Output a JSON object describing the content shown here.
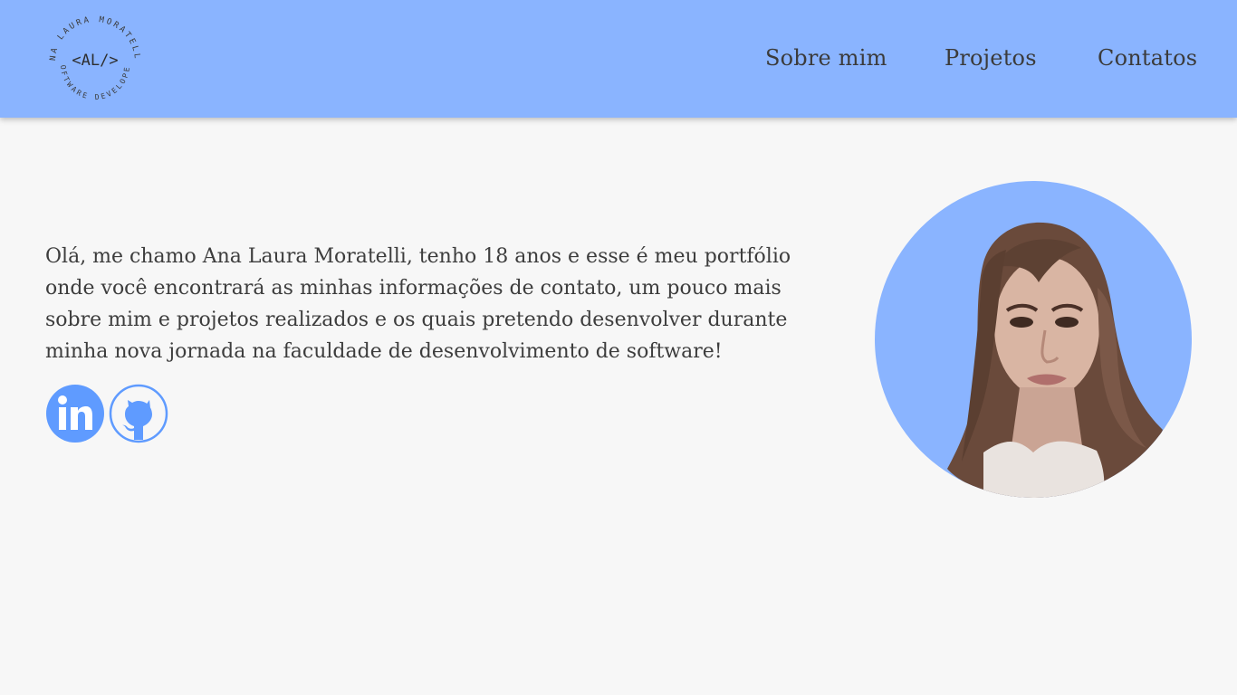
{
  "logo": {
    "name": "ANA LAURA MORATELLI",
    "role": "SOFTWARE DEVELOPER",
    "monogram": "<AL/>"
  },
  "nav": {
    "items": [
      {
        "label": "Sobre mim"
      },
      {
        "label": "Projetos"
      },
      {
        "label": "Contatos"
      }
    ]
  },
  "intro": {
    "text": "Olá, me chamo Ana Laura Moratelli, tenho 18 anos e esse é meu portfólio onde você encontrará as minhas informações de contato, um pouco mais sobre mim e projetos realizados e os quais pretendo desenvolver durante minha nova jornada na faculdade de desenvolvimento de software!"
  },
  "social": {
    "icons": [
      "linkedin-icon",
      "github-icon"
    ]
  },
  "colors": {
    "accent": "#8ab4ff",
    "icon_blue": "#5f9bff",
    "background": "#f7f7f7",
    "text": "#3d3d3d"
  },
  "icons": {
    "photo": "profile-photo"
  }
}
